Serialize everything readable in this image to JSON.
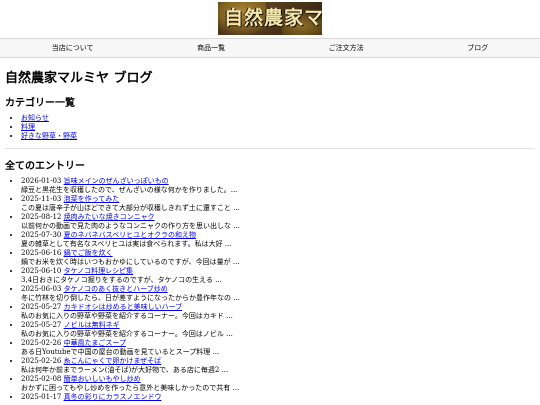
{
  "header": {
    "logo_text": "自然農家マルミヤ"
  },
  "nav": {
    "items": [
      "当店について",
      "商品一覧",
      "ご注文方法",
      "ブログ"
    ]
  },
  "main": {
    "title": "自然農家マルミヤ ブログ",
    "categories_heading": "カテゴリー一覧",
    "categories": [
      "お知らせ",
      "料理",
      "好きな野草・野菜"
    ],
    "entries_heading": "全てのエントリー",
    "entries": [
      {
        "date": "2026-01-03",
        "title": "旨味メインのぜんざいっぽいもの",
        "excerpt": "緑豆と黒花生を収穫したので、ぜんざいの様な何かを作りました。..."
      },
      {
        "date": "2025-11-03",
        "title": "泡菜を作ってみた",
        "excerpt": "この夏は唐辛子が山ほどできて大部分が収穫しきれず土に還すこと ..."
      },
      {
        "date": "2025-08-12",
        "title": "焼肉みたいな焼きコンニャク",
        "excerpt": "以前何かの動画で見た肉のようなコンニャクの作り方を思い出しな ..."
      },
      {
        "date": "2025-07-30",
        "title": "夏のネバネバスベリヒユとオクラの和え物",
        "excerpt": "夏の雑草として有名なスベリヒユは実は食べられます。私は大好 ..."
      },
      {
        "date": "2025-06-16",
        "title": "鍋でご飯を炊く",
        "excerpt": "鍋でお米を炊く時はいつもおかゆにしているのですが、今回は量が ..."
      },
      {
        "date": "2025-06-10",
        "title": "タケノコ料理レシピ集",
        "excerpt": "3,4日おきにタケノコ掘りをするのですが、タケノコの生える ..."
      },
      {
        "date": "2025-06-03",
        "title": "タケノコのあく抜きとハーブ炒め",
        "excerpt": "冬に竹林を切り倒したら、日が差すようになったからか豊作年なの ..."
      },
      {
        "date": "2025-05-27",
        "title": "カキドオシは炒めると美味しいハーブ",
        "excerpt": "私のお気に入りの野草や野菜を紹介するコーナー。今回はカキド ..."
      },
      {
        "date": "2025-05-27",
        "title": "ノビルは無料ネギ",
        "excerpt": "私のお気に入りの野草や野菜を紹介するコーナー。今回はノビル ..."
      },
      {
        "date": "2025-02-26",
        "title": "中華風たまごスープ",
        "excerpt": "ある日Youtubeで中国の屋台の動画を見ているとスープ料理 ..."
      },
      {
        "date": "2025-02-26",
        "title": "糸こんにゃくで卵かけまぜそば",
        "excerpt": "私は何年か前までラーメン(油そば)が大好物で、ある店に毎週2 ..."
      },
      {
        "date": "2025-02-08",
        "title": "簡単おいしいもやし炒め",
        "excerpt": "おかずに困ってもやし炒めを作ったら意外と美味しかったので共有 ..."
      },
      {
        "date": "2025-01-17",
        "title": "真冬の彩りにカラスノエンドウ",
        "excerpt": ""
      }
    ]
  }
}
